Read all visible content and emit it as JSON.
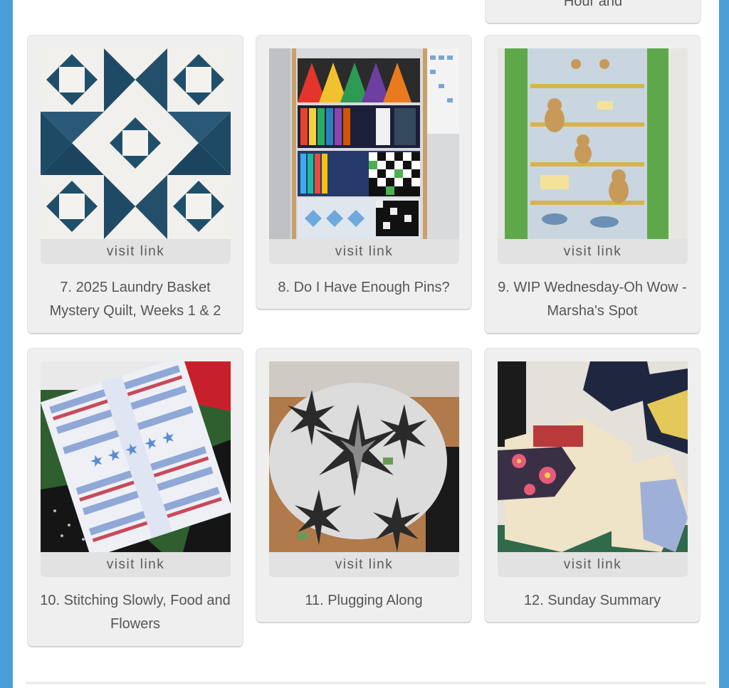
{
  "top_partial_card": {
    "title_fragment": "Hour and"
  },
  "visit_label": "visit link",
  "cards": [
    {
      "title": "7. 2025 Laundry Basket Mystery Quilt, Weeks 1 & 2"
    },
    {
      "title": "8. Do I Have Enough Pins?"
    },
    {
      "title": "9. WIP Wednesday-Oh Wow - Marsha's Spot"
    },
    {
      "title": "10. Stitching Slowly, Food and Flowers"
    },
    {
      "title": "11. Plugging Along"
    },
    {
      "title": "12. Sunday Summary"
    }
  ],
  "colors": {
    "frame_blue": "#4a9fd8",
    "card_bg": "#efefef",
    "visit_bg": "#e2e2e2",
    "text": "#555555"
  }
}
